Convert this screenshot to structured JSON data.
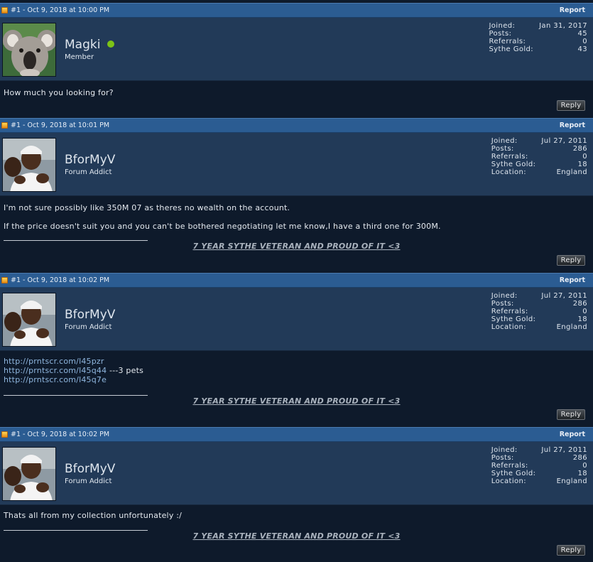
{
  "posts": [
    {
      "date": "#1 - Oct 9, 2018 at 10:00 PM",
      "report": "Report",
      "username": "Magki",
      "title": "Member",
      "info": [
        {
          "label": "Joined:",
          "value": "Jan 31, 2017"
        },
        {
          "label": "Posts:",
          "value": "45"
        },
        {
          "label": "Referrals:",
          "value": "0"
        },
        {
          "label": "Sythe Gold:",
          "value": "43"
        }
      ],
      "lines": [
        "How much you looking for?"
      ],
      "reply": "Reply"
    },
    {
      "date": "#1 - Oct 9, 2018 at 10:01 PM",
      "report": "Report",
      "username": "BforMyV",
      "title": "Forum Addict",
      "info": [
        {
          "label": "Joined:",
          "value": "Jul 27, 2011"
        },
        {
          "label": "Posts:",
          "value": "286"
        },
        {
          "label": "Referrals:",
          "value": "0"
        },
        {
          "label": "Sythe Gold:",
          "value": "18"
        },
        {
          "label": "Location:",
          "value": "England"
        }
      ],
      "lines": [
        "I'm not sure possibly like 350M 07 as theres no wealth on the account.",
        "If the price doesn't suit you and you can't be bothered negotiating let me know,I have a third one for 300M."
      ],
      "signature": "7 YEAR SYTHE VETERAN AND PROUD OF IT <3",
      "reply": "Reply"
    },
    {
      "date": "#1 - Oct 9, 2018 at 10:02 PM",
      "report": "Report",
      "username": "BforMyV",
      "title": "Forum Addict",
      "info": [
        {
          "label": "Joined:",
          "value": "Jul 27, 2011"
        },
        {
          "label": "Posts:",
          "value": "286"
        },
        {
          "label": "Referrals:",
          "value": "0"
        },
        {
          "label": "Sythe Gold:",
          "value": "18"
        },
        {
          "label": "Location:",
          "value": "England"
        }
      ],
      "links": [
        {
          "url": "http://prntscr.com/l45pzr",
          "note": ""
        },
        {
          "url": "http://prntscr.com/l45q44",
          "note": " ---3 pets"
        },
        {
          "url": "http://prntscr.com/l45q7e",
          "note": ""
        }
      ],
      "signature": "7 YEAR SYTHE VETERAN AND PROUD OF IT <3",
      "reply": "Reply"
    },
    {
      "date": "#1 - Oct 9, 2018 at 10:02 PM",
      "report": "Report",
      "username": "BforMyV",
      "title": "Forum Addict",
      "info": [
        {
          "label": "Joined:",
          "value": "Jul 27, 2011"
        },
        {
          "label": "Posts:",
          "value": "286"
        },
        {
          "label": "Referrals:",
          "value": "0"
        },
        {
          "label": "Sythe Gold:",
          "value": "18"
        },
        {
          "label": "Location:",
          "value": "England"
        }
      ],
      "lines": [
        "Thats all from my collection unfortunately :/"
      ],
      "signature": "7 YEAR SYTHE VETERAN AND PROUD OF IT <3",
      "reply": "Reply"
    }
  ]
}
